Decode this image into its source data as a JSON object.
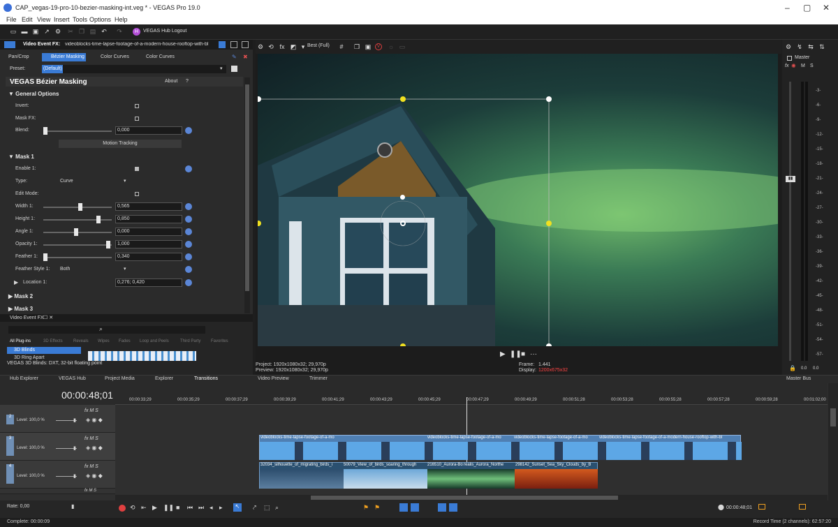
{
  "window": {
    "title": "CAP_vegas-19-pro-10-bezier-masking-int.veg * - VEGAS Pro 19.0",
    "minimize": "–",
    "maximize": "▢",
    "close": "✕"
  },
  "menu": [
    "File",
    "Edit",
    "View",
    "Insert",
    "Tools",
    "Options",
    "Help"
  ],
  "toolbar": {
    "hub_logout": "VEGAS Hub Logout"
  },
  "fx_header": {
    "label": "Video Event FX:",
    "media": "videoblocks-time-lapse-footage-of-a-modern-house-rooftop-with-bl"
  },
  "fx_chain": [
    "Pan/Crop",
    "Bézier Masking",
    "Color Curves",
    "Color Curves"
  ],
  "preset": {
    "label": "Preset:",
    "value": "(Default)"
  },
  "plugin": {
    "title": "VEGAS Bézier Masking",
    "about": "About",
    "help": "?"
  },
  "general": {
    "title": "General Options",
    "invert": "Invert:",
    "mask_fx": "Mask FX:",
    "blend": "Blend:",
    "blend_value": "0,000",
    "motion_tracking": "Motion Tracking",
    "blend_frac": 0.0
  },
  "mask1": {
    "title": "Mask 1",
    "enable": "Enable 1:",
    "type_label": "Type:",
    "type_value": "Curve",
    "edit_mode": "Edit Mode:",
    "width_label": "Width 1:",
    "width_value": "0,565",
    "height_label": "Height 1:",
    "height_value": "0,850",
    "angle_label": "Angle 1:",
    "angle_value": "0,000",
    "opacity_label": "Opacity 1:",
    "opacity_value": "1,000",
    "feather_label": "Feather 1:",
    "feather_value": "0,340",
    "feather_style_label": "Feather Style 1:",
    "feather_style_value": "Both",
    "location_label": "Location 1:",
    "location_value": "0,276; 0,420"
  },
  "masks_collapsed": [
    "Mask 2",
    "Mask 3"
  ],
  "video_fx_tab": "Video Event FX",
  "plugin_tabs": [
    "All Plug-ins",
    "3D Effects",
    "Reveals",
    "Wipes",
    "Fades",
    "Loop and Peels",
    "Third Party",
    "Favorites"
  ],
  "plugin_list": [
    "3D Blinds",
    "3D Ring Apart"
  ],
  "plugin_desc": "VEGAS 3D Blinds: DXT, 32-bit floating point",
  "preview": {
    "quality": "Best (Full)",
    "project": "Project:  1920x1080x32; 29,970p",
    "preview": "Preview:  1920x1080x32; 29,970p",
    "frame_label": "Frame:",
    "frame_value": "1.441",
    "display_label": "Display:",
    "display_value": "1200x675x32"
  },
  "mixer": {
    "master": "Master",
    "fx": "fx",
    "m": "M",
    "s": "S",
    "scale": [
      "-3-",
      "-6-",
      "-9-",
      "-12-",
      "-15-",
      "-18-",
      "-21-",
      "-24-",
      "-27-",
      "-30-",
      "-33-",
      "-36-",
      "-39-",
      "-42-",
      "-45-",
      "-48-",
      "-51-",
      "-54-",
      "-57-"
    ],
    "left_val": "0.0",
    "right_val": "0.0"
  },
  "bottom_tabs": [
    "Hub Explorer",
    "VEGAS Hub",
    "Project Media",
    "Explorer",
    "Transitions",
    "Video Preview",
    "Trimmer",
    "Master Bus"
  ],
  "timeline": {
    "timecode": "00:00:48;01",
    "ruler": [
      "00:00:33;29",
      "00:00:35;29",
      "00:00:37;29",
      "00:00:39;29",
      "00:00:41;29",
      "00:00:43;29",
      "00:00:45;29",
      "00:00:47;29",
      "00:00:49;29",
      "00:00:51;28",
      "00:00:53;28",
      "00:00:55;28",
      "00:00:57;28",
      "00:00:59;28",
      "00:01:02;00"
    ],
    "tracks": [
      {
        "num": "2",
        "level": "Level: 100,0 %"
      },
      {
        "num": "3",
        "level": "Level: 100,0 %"
      },
      {
        "num": "4",
        "level": "Level: 100,0 %"
      }
    ],
    "clip_top": "videoblocks-time-lapse-footage-of-a-mo",
    "clip_top2": "videoblocks-time-lapse-footage-of-a-modern-house-rooftop-with-bl",
    "clips_bottom": [
      "32034_silhouette_of_migrating_birds_i",
      "50079_View_of_birds_soaring_through",
      "216510_Aurora-Bo",
      "realis_Aurora_Northe",
      "298142_Sunset_Sea_Sky_Clouds_by_B"
    ],
    "rate": "Rate: 0,00",
    "cursor_time": "00:00:48;01"
  },
  "status": {
    "left": "Complete: 00:00:09",
    "right": "Record Time (2 channels): 62:57:20"
  },
  "colors": {
    "accent": "#3a7bd5",
    "mask_yellow": "#f0e020",
    "display_red": "#ff4444"
  }
}
